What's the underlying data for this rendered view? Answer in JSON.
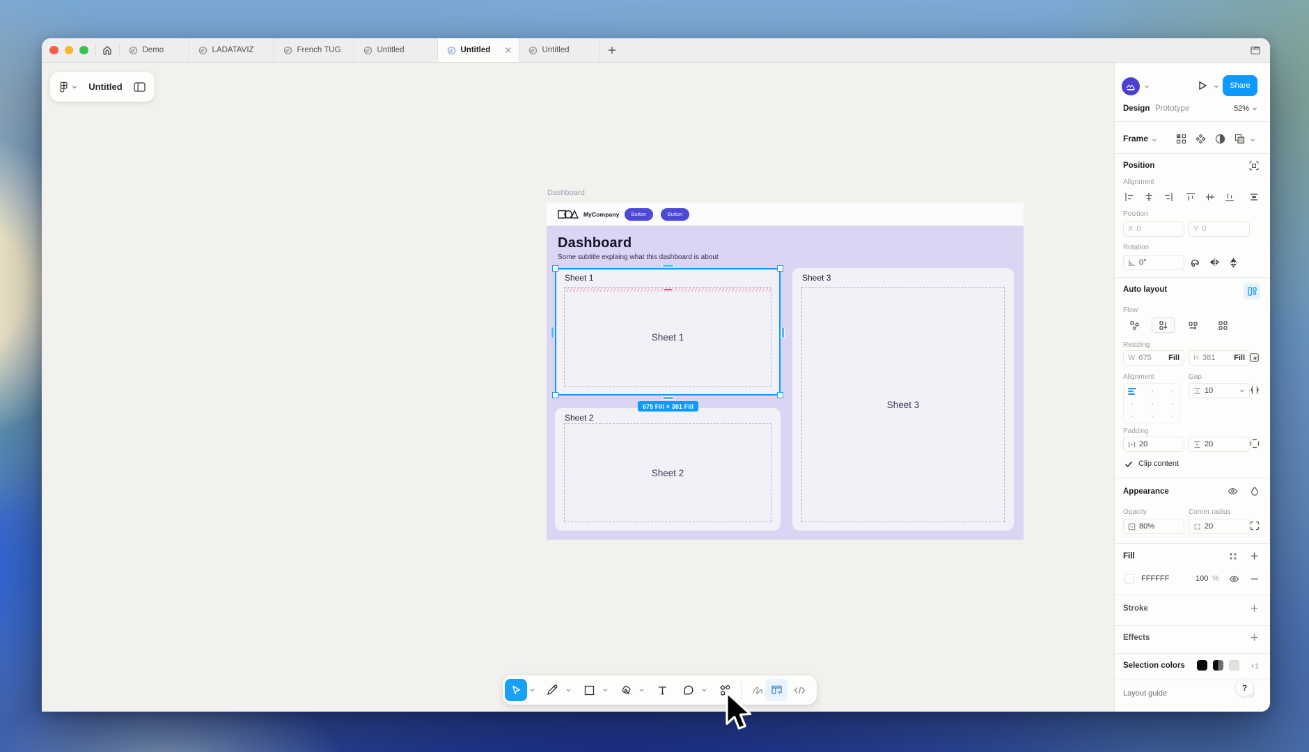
{
  "colors": {
    "accent_blue": "#0d99ff",
    "tool_blue": "#18a0fb",
    "indigo_button": "#4c48d8",
    "lavender_bg": "#d9d5f2",
    "avatar_purple": "#4b40d2"
  },
  "window": {
    "tabs": [
      {
        "label": "Demo",
        "active": false
      },
      {
        "label": "LADATAVIZ",
        "active": false
      },
      {
        "label": "French TUG",
        "active": false
      },
      {
        "label": "Untitled",
        "active": false
      },
      {
        "label": "Untitled",
        "active": true
      },
      {
        "label": "Untitled",
        "active": false
      }
    ],
    "doc_toolbar": {
      "title": "Untitled"
    }
  },
  "canvas": {
    "frame_label": "Dashboard",
    "design": {
      "brand": "MyCompany",
      "nav_buttons": {
        "first": "Button",
        "second": "Button"
      },
      "title": "Dashboard",
      "subtitle": "Some subtitle explaing what this dashboard is about",
      "sheets": [
        {
          "label": "Sheet 1",
          "placeholder": "Sheet 1"
        },
        {
          "label": "Sheet 2",
          "placeholder": "Sheet 2"
        },
        {
          "label": "Sheet 3",
          "placeholder": "Sheet 3"
        }
      ]
    },
    "selection_badge": "675 Fill × 381 Fill"
  },
  "sidebar": {
    "share_label": "Share",
    "mode_tabs": {
      "design": "Design",
      "prototype": "Prototype"
    },
    "zoom": "52%",
    "frame_section": {
      "label": "Frame"
    },
    "position": {
      "header": "Position",
      "alignment_label": "Alignment",
      "position_label": "Position",
      "x_label": "X",
      "x_value": "0",
      "y_label": "Y",
      "y_value": "0",
      "rotation_label": "Rotation",
      "rotation_value": "0°"
    },
    "auto_layout": {
      "header": "Auto layout",
      "flow_label": "Flow",
      "resizing_label": "Resizing",
      "w_label": "W",
      "w_value": "675",
      "w_mode": "Fill",
      "h_label": "H",
      "h_value": "381",
      "h_mode": "Fill",
      "alignment_label": "Alignment",
      "gap_label": "Gap",
      "gap_value": "10",
      "padding_label": "Padding",
      "padding_horizontal": "20",
      "padding_vertical": "20",
      "clip_label": "Clip content"
    },
    "appearance": {
      "header": "Appearance",
      "opacity_label": "Opacity",
      "opacity_value": "80%",
      "radius_label": "Corner radius",
      "radius_value": "20"
    },
    "fill": {
      "header": "Fill",
      "hex": "FFFFFF",
      "opacity": "100",
      "unit": "%"
    },
    "stroke": {
      "header": "Stroke"
    },
    "effects": {
      "header": "Effects"
    },
    "selection_colors": {
      "header": "Selection colors",
      "overflow": "+1"
    },
    "layout_guide": "Layout guide",
    "help": "?"
  }
}
